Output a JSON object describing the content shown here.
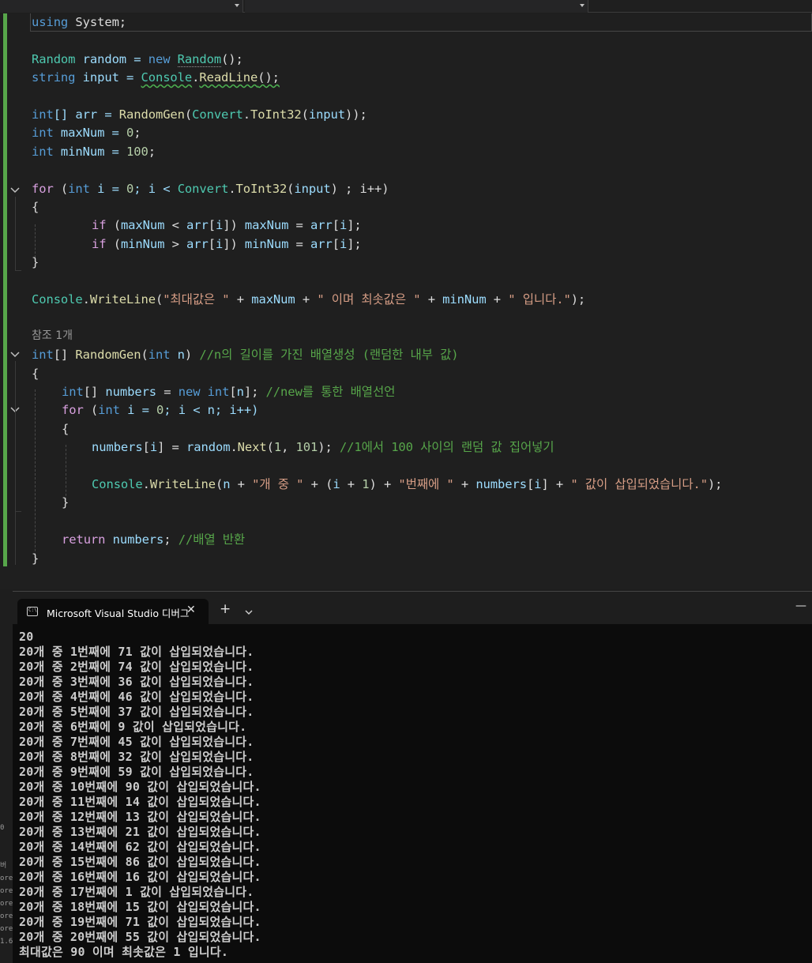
{
  "editor": {
    "lines": [
      {
        "row": 0,
        "indent": 0,
        "tokens": [
          [
            "using",
            "kw"
          ],
          [
            " System;",
            "pl"
          ]
        ]
      },
      {
        "row": 2,
        "indent": 0,
        "tokens": [
          [
            "Random",
            "ty"
          ],
          [
            " random = ",
            "vr"
          ],
          [
            "new",
            "kw"
          ],
          [
            " ",
            "pl"
          ],
          [
            "Random",
            "ty"
          ],
          [
            "();",
            "pl"
          ]
        ]
      },
      {
        "row": 3,
        "indent": 0,
        "tokens": [
          [
            "string",
            "kw"
          ],
          [
            " input = ",
            "vr"
          ],
          [
            "Console",
            "ty"
          ],
          [
            ".",
            "pl"
          ],
          [
            "ReadLine",
            "mt"
          ],
          [
            "();",
            "pl"
          ]
        ]
      },
      {
        "row": 5,
        "indent": 0,
        "tokens": [
          [
            "int",
            "kw"
          ],
          [
            "[] arr = ",
            "vr"
          ],
          [
            "RandomGen",
            "mt"
          ],
          [
            "(",
            "pl"
          ],
          [
            "Convert",
            "ty"
          ],
          [
            ".",
            "pl"
          ],
          [
            "ToInt32",
            "mt"
          ],
          [
            "(",
            "pl"
          ],
          [
            "input",
            "vr"
          ],
          [
            "));",
            "pl"
          ]
        ]
      },
      {
        "row": 6,
        "indent": 0,
        "tokens": [
          [
            "int",
            "kw"
          ],
          [
            " maxNum = ",
            "vr"
          ],
          [
            "0",
            "nm"
          ],
          [
            ";",
            "pl"
          ]
        ]
      },
      {
        "row": 7,
        "indent": 0,
        "tokens": [
          [
            "int",
            "kw"
          ],
          [
            " minNum = ",
            "vr"
          ],
          [
            "100",
            "nm"
          ],
          [
            ";",
            "pl"
          ]
        ]
      },
      {
        "row": 9,
        "indent": 0,
        "tokens": [
          [
            "for",
            "ctl"
          ],
          [
            " (",
            "pl"
          ],
          [
            "int",
            "kw"
          ],
          [
            " i = ",
            "vr"
          ],
          [
            "0",
            "nm"
          ],
          [
            "; i < ",
            "vr"
          ],
          [
            "Convert",
            "ty"
          ],
          [
            ".",
            "pl"
          ],
          [
            "ToInt32",
            "mt"
          ],
          [
            "(",
            "pl"
          ],
          [
            "input",
            "vr"
          ],
          [
            ") ; i++)",
            "pl"
          ]
        ]
      },
      {
        "row": 10,
        "indent": 0,
        "tokens": [
          [
            "{",
            "pl"
          ]
        ]
      },
      {
        "row": 11,
        "indent": 2,
        "tokens": [
          [
            "if",
            "ctl"
          ],
          [
            " (",
            "pl"
          ],
          [
            "maxNum",
            "vr"
          ],
          [
            " < ",
            "pl"
          ],
          [
            "arr",
            "vr"
          ],
          [
            "[",
            "pl"
          ],
          [
            "i",
            "vr"
          ],
          [
            "]) ",
            "pl"
          ],
          [
            "maxNum",
            "vr"
          ],
          [
            " = ",
            "pl"
          ],
          [
            "arr",
            "vr"
          ],
          [
            "[",
            "pl"
          ],
          [
            "i",
            "vr"
          ],
          [
            "];",
            "pl"
          ]
        ]
      },
      {
        "row": 12,
        "indent": 2,
        "tokens": [
          [
            "if",
            "ctl"
          ],
          [
            " (",
            "pl"
          ],
          [
            "minNum",
            "vr"
          ],
          [
            " > ",
            "pl"
          ],
          [
            "arr",
            "vr"
          ],
          [
            "[",
            "pl"
          ],
          [
            "i",
            "vr"
          ],
          [
            "]) ",
            "pl"
          ],
          [
            "minNum",
            "vr"
          ],
          [
            " = ",
            "pl"
          ],
          [
            "arr",
            "vr"
          ],
          [
            "[",
            "pl"
          ],
          [
            "i",
            "vr"
          ],
          [
            "];",
            "pl"
          ]
        ]
      },
      {
        "row": 13,
        "indent": 0,
        "tokens": [
          [
            "}",
            "pl"
          ]
        ]
      },
      {
        "row": 15,
        "indent": 0,
        "tokens": [
          [
            "Console",
            "ty"
          ],
          [
            ".",
            "pl"
          ],
          [
            "WriteLine",
            "mt"
          ],
          [
            "(",
            "pl"
          ],
          [
            "\"최대값은 \"",
            "st"
          ],
          [
            " + ",
            "pl"
          ],
          [
            "maxNum",
            "vr"
          ],
          [
            " + ",
            "pl"
          ],
          [
            "\" 이며 최솟값은 \"",
            "st"
          ],
          [
            " + ",
            "pl"
          ],
          [
            "minNum",
            "vr"
          ],
          [
            " + ",
            "pl"
          ],
          [
            "\" 입니다.\"",
            "st"
          ],
          [
            ");",
            "pl"
          ]
        ]
      },
      {
        "row": 18,
        "indent": 0,
        "tokens": [
          [
            "int",
            "kw"
          ],
          [
            "[] ",
            "pl"
          ],
          [
            "RandomGen",
            "mt"
          ],
          [
            "(",
            "pl"
          ],
          [
            "int",
            "kw"
          ],
          [
            " ",
            "pl"
          ],
          [
            "n",
            "vr"
          ],
          [
            ") ",
            "pl"
          ],
          [
            "//n의 길이를 가진 배열생성 (랜덤한 내부 값)",
            "cm"
          ]
        ]
      },
      {
        "row": 19,
        "indent": 0,
        "tokens": [
          [
            "{",
            "pl"
          ]
        ]
      },
      {
        "row": 20,
        "indent": 1,
        "tokens": [
          [
            "int",
            "kw"
          ],
          [
            "[] ",
            "pl"
          ],
          [
            "numbers",
            "vr"
          ],
          [
            " = ",
            "pl"
          ],
          [
            "new",
            "kw"
          ],
          [
            " ",
            "pl"
          ],
          [
            "int",
            "kw"
          ],
          [
            "[",
            "pl"
          ],
          [
            "n",
            "vr"
          ],
          [
            "]; ",
            "pl"
          ],
          [
            "//new를 통한 배열선언",
            "cm"
          ]
        ]
      },
      {
        "row": 21,
        "indent": 1,
        "tokens": [
          [
            "for",
            "ctl"
          ],
          [
            " (",
            "pl"
          ],
          [
            "int",
            "kw"
          ],
          [
            " i = ",
            "vr"
          ],
          [
            "0",
            "nm"
          ],
          [
            "; i < n; i++)",
            "vr"
          ]
        ]
      },
      {
        "row": 22,
        "indent": 1,
        "tokens": [
          [
            "{",
            "pl"
          ]
        ]
      },
      {
        "row": 23,
        "indent": 2,
        "tokens": [
          [
            "numbers",
            "vr"
          ],
          [
            "[",
            "pl"
          ],
          [
            "i",
            "vr"
          ],
          [
            "] = ",
            "pl"
          ],
          [
            "random",
            "vr"
          ],
          [
            ".",
            "pl"
          ],
          [
            "Next",
            "mt"
          ],
          [
            "(",
            "pl"
          ],
          [
            "1",
            "nm"
          ],
          [
            ", ",
            "pl"
          ],
          [
            "101",
            "nm"
          ],
          [
            "); ",
            "pl"
          ],
          [
            "//1에서 100 사이의 랜덤 값 집어넣기",
            "cm"
          ]
        ]
      },
      {
        "row": 25,
        "indent": 2,
        "tokens": [
          [
            "Console",
            "ty"
          ],
          [
            ".",
            "pl"
          ],
          [
            "WriteLine",
            "mt"
          ],
          [
            "(",
            "pl"
          ],
          [
            "n",
            "vr"
          ],
          [
            " + ",
            "pl"
          ],
          [
            "\"개 중 \"",
            "st"
          ],
          [
            " + (",
            "pl"
          ],
          [
            "i",
            "vr"
          ],
          [
            " + ",
            "pl"
          ],
          [
            "1",
            "nm"
          ],
          [
            ") + ",
            "pl"
          ],
          [
            "\"번째에 \"",
            "st"
          ],
          [
            " + ",
            "pl"
          ],
          [
            "numbers",
            "vr"
          ],
          [
            "[",
            "pl"
          ],
          [
            "i",
            "vr"
          ],
          [
            "] + ",
            "pl"
          ],
          [
            "\" 값이 삽입되었습니다.\"",
            "st"
          ],
          [
            ");",
            "pl"
          ]
        ]
      },
      {
        "row": 26,
        "indent": 1,
        "tokens": [
          [
            "}",
            "pl"
          ]
        ]
      },
      {
        "row": 28,
        "indent": 1,
        "tokens": [
          [
            "return",
            "ctl"
          ],
          [
            " ",
            "pl"
          ],
          [
            "numbers",
            "vr"
          ],
          [
            "; ",
            "pl"
          ],
          [
            "//배열 반환",
            "cm"
          ]
        ]
      },
      {
        "row": 29,
        "indent": 0,
        "tokens": [
          [
            "}",
            "pl"
          ]
        ]
      }
    ],
    "codelens": "참조 1개"
  },
  "console": {
    "tab_title": "Microsoft Visual Studio 디버그",
    "close_glyph": "✕",
    "add_glyph": "+",
    "minimize_glyph": "—",
    "output": [
      "20",
      "20개 중 1번째에 71 값이 삽입되었습니다.",
      "20개 중 2번째에 74 값이 삽입되었습니다.",
      "20개 중 3번째에 36 값이 삽입되었습니다.",
      "20개 중 4번째에 46 값이 삽입되었습니다.",
      "20개 중 5번째에 37 값이 삽입되었습니다.",
      "20개 중 6번째에 9 값이 삽입되었습니다.",
      "20개 중 7번째에 45 값이 삽입되었습니다.",
      "20개 중 8번째에 32 값이 삽입되었습니다.",
      "20개 중 9번째에 59 값이 삽입되었습니다.",
      "20개 중 10번째에 90 값이 삽입되었습니다.",
      "20개 중 11번째에 14 값이 삽입되었습니다.",
      "20개 중 12번째에 13 값이 삽입되었습니다.",
      "20개 중 13번째에 21 값이 삽입되었습니다.",
      "20개 중 14번째에 62 값이 삽입되었습니다.",
      "20개 중 15번째에 86 값이 삽입되었습니다.",
      "20개 중 16번째에 16 값이 삽입되었습니다.",
      "20개 중 17번째에 1 값이 삽입되었습니다.",
      "20개 중 18번째에 15 값이 삽입되었습니다.",
      "20개 중 19번째에 71 값이 삽입되었습니다.",
      "20개 중 20번째에 55 값이 삽입되었습니다.",
      "최대값은 90 이며 최솟값은 1 입니다."
    ]
  },
  "left_strip": [
    "0",
    "",
    "",
    "버",
    "ore",
    "ore",
    "ore",
    "ore",
    "ore",
    "1.6"
  ]
}
